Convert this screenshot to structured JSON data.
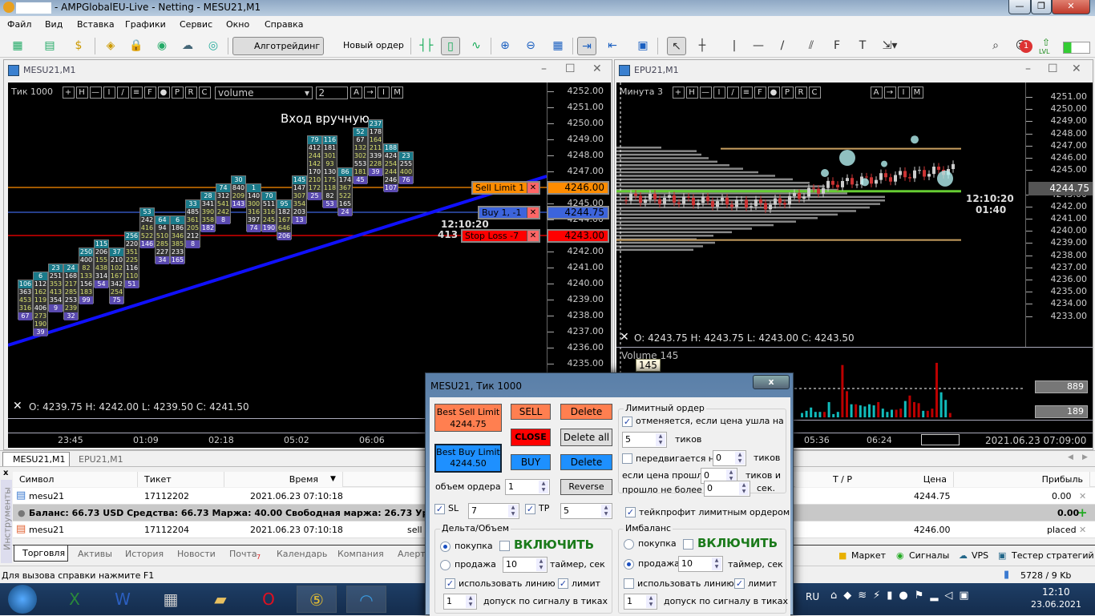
{
  "window": {
    "title": "- AMPGlobalEU-Live - Netting - MESU21,M1",
    "minimize": "—",
    "maximize": "❐",
    "close": "✕"
  },
  "menu": [
    "Файл",
    "Вид",
    "Вставка",
    "Графики",
    "Сервис",
    "Окно",
    "Справка"
  ],
  "toolbar": {
    "algo": "Алготрейдинг",
    "new_order": "Новый ордер",
    "notif_count": "1",
    "lvl": "LVL"
  },
  "left_chart": {
    "title": "MESU21,M1",
    "timeframe": "Тик  1000",
    "indicator_select": "volume",
    "indicator_value": "2",
    "tool_buttons": [
      "+",
      "H",
      "—",
      "I",
      "/",
      "≡",
      "F",
      "●",
      "P",
      "R",
      "C"
    ],
    "tool_buttons2": [
      "A",
      "→",
      "I",
      "M"
    ],
    "note": "Вход вручную.",
    "price_labels": [
      "4252.00",
      "4251.00",
      "4250.00",
      "4249.00",
      "4248.00",
      "4247.00",
      "4246.00",
      "4245.00",
      "4244.00",
      "4243.00",
      "4242.00",
      "4241.00",
      "4240.00",
      "4239.00",
      "4238.00",
      "4237.00",
      "4236.00",
      "4235.00"
    ],
    "time_labels": [
      "23:45",
      "01:09",
      "02:18",
      "05:02",
      "06:06"
    ],
    "ohlc": "O: 4239.75  H: 4242.00  L: 4239.50  C: 4241.50",
    "timer": "12:10:20",
    "timer2": "413",
    "orders": [
      {
        "label": "Sell Limit  1",
        "price": "4246.00",
        "color": "#ff8c00"
      },
      {
        "label": "Buy  1,  -1",
        "price": "4244.75",
        "color": "#3c64dc"
      },
      {
        "label": "Stop Loss  -7",
        "price": "4243.00",
        "color": "#ff0000"
      }
    ],
    "footprint": [
      {
        "top": 4240.0,
        "v": [
          "106",
          "363",
          "453",
          "316",
          "67"
        ]
      },
      {
        "top": 4240.5,
        "v": [
          "6",
          "112",
          "162",
          "119",
          "406",
          "273",
          "190",
          "39"
        ]
      },
      {
        "top": 4241.0,
        "v": [
          "23",
          "251",
          "353",
          "413",
          "354",
          "9"
        ]
      },
      {
        "top": 4241.0,
        "v": [
          "24",
          "168",
          "217",
          "285",
          "253",
          "239",
          "32"
        ]
      },
      {
        "top": 4242.0,
        "v": [
          "250",
          "400",
          "82",
          "133",
          "156",
          "183",
          "99"
        ]
      },
      {
        "top": 4242.5,
        "v": [
          "115",
          "206",
          "155",
          "438",
          "314",
          "54"
        ]
      },
      {
        "top": 4242.0,
        "v": [
          "37",
          "210",
          "102",
          "167",
          "342",
          "254",
          "75"
        ]
      },
      {
        "top": 4243.0,
        "v": [
          "256",
          "220",
          "351",
          "225",
          "116",
          "110",
          "51"
        ]
      },
      {
        "top": 4244.5,
        "v": [
          "53",
          "242",
          "416",
          "522",
          "146"
        ]
      },
      {
        "top": 4244.0,
        "v": [
          "64",
          "94",
          "510",
          "285",
          "227",
          "34"
        ]
      },
      {
        "top": 4244.0,
        "v": [
          "6",
          "186",
          "346",
          "385",
          "233",
          "165"
        ]
      },
      {
        "top": 4245.0,
        "v": [
          "33",
          "485",
          "361",
          "205",
          "212",
          "8"
        ]
      },
      {
        "top": 4245.5,
        "v": [
          "28",
          "341",
          "390",
          "358",
          "182"
        ]
      },
      {
        "top": 4246.0,
        "v": [
          "74",
          "312",
          "541",
          "242",
          "8"
        ]
      },
      {
        "top": 4246.5,
        "v": [
          "30",
          "840",
          "209",
          "143"
        ]
      },
      {
        "top": 4246.0,
        "v": [
          "1",
          "140",
          "300",
          "316",
          "397",
          "74"
        ]
      },
      {
        "top": 4245.5,
        "v": [
          "70",
          "511",
          "316",
          "245",
          "190"
        ]
      },
      {
        "top": 4245.0,
        "v": [
          "95",
          "182",
          "167",
          "646",
          "206"
        ]
      },
      {
        "top": 4246.5,
        "v": [
          "145",
          "147",
          "307",
          "354",
          "203",
          "13"
        ]
      },
      {
        "top": 4249.0,
        "v": [
          "79",
          "412",
          "244",
          "142",
          "170",
          "210",
          "172",
          "25"
        ]
      },
      {
        "top": 4249.0,
        "v": [
          "116",
          "181",
          "301",
          "93",
          "130",
          "175",
          "118",
          "82",
          "53"
        ]
      },
      {
        "top": 4247.0,
        "v": [
          "86",
          "174",
          "367",
          "522",
          "165",
          "24"
        ]
      },
      {
        "top": 4249.5,
        "v": [
          "52",
          "67",
          "132",
          "302",
          "553",
          "181",
          "45"
        ]
      },
      {
        "top": 4250.0,
        "v": [
          "237",
          "178",
          "164",
          "211",
          "339",
          "228",
          "39"
        ]
      },
      {
        "top": 4248.5,
        "v": [
          "188",
          "424",
          "254",
          "244",
          "246",
          "107"
        ]
      },
      {
        "top": 4248.0,
        "v": [
          "23",
          "255",
          "400",
          "76"
        ]
      }
    ]
  },
  "right_chart": {
    "title": "EPU21,M1",
    "timeframe": "Минута  3",
    "price_labels": [
      "4251.00",
      "4250.00",
      "4249.00",
      "4248.00",
      "4247.00",
      "4246.00",
      "4245.00",
      "4243.00",
      "4242.00",
      "4241.00",
      "4240.00",
      "4239.00",
      "4238.00",
      "4237.00",
      "4236.00",
      "4235.00",
      "4234.00",
      "4233.00"
    ],
    "current_price": "4244.75",
    "timer": "12:10:20",
    "timer2": "01:40",
    "ohlc": "O: 4243.75  H: 4243.75  L: 4243.00  C: 4243.50",
    "volume_label": "Volume 145",
    "volume_tooltip": "145",
    "vol_high": "889",
    "vol_low": "189",
    "time_labels": [
      "05:36",
      "06:24"
    ],
    "date_label": "2021.06.23 07:09:00",
    "volumes": [
      20,
      30,
      45,
      25,
      25,
      25,
      70,
      15,
      25,
      240,
      120,
      60,
      60,
      55,
      50,
      60,
      55,
      70,
      40,
      25,
      35,
      35,
      40,
      75,
      100,
      70,
      65,
      30,
      30,
      40,
      250,
      115,
      80,
      20
    ]
  },
  "chart_tabs": [
    "MESU21,M1",
    "EPU21,M1"
  ],
  "toolbox": {
    "side_label": "Инструменты",
    "columns": [
      "Символ",
      "Тикет",
      "Время",
      "T / P",
      "Цена",
      "Прибыль"
    ],
    "rows": [
      {
        "symbol": "mesu21",
        "ticket": "17112202",
        "time": "2021.06.23 07:10:18",
        "type": "",
        "price": "4244.75",
        "profit": "0.00"
      },
      {
        "symbol": "mesu21",
        "ticket": "17112204",
        "time": "2021.06.23 07:10:18",
        "type": "sell",
        "price": "4246.00",
        "profit": "placed"
      }
    ],
    "balance": "Баланс: 66.73 USD  Средства: 66.73  Маржа: 40.00  Свободная маржа: 26.73  Уровень маржи",
    "balance_profit": "0.00",
    "tabs": [
      "Торговля",
      "Активы",
      "История",
      "Новости",
      "Почта",
      "Календарь",
      "Компания",
      "Алерты"
    ],
    "mail_count": "7",
    "right_links": [
      "Маркет",
      "Сигналы",
      "VPS",
      "Тестер стратегий"
    ]
  },
  "status": {
    "help": "Для вызова справки нажмите F1",
    "traffic": "5728 / 9 Kb"
  },
  "dialog": {
    "title": "MESU21, Тик  1000",
    "close": "x",
    "best_sell": "Best Sell Limit",
    "best_sell_price": "4244.75",
    "best_buy": "Best Buy Limit",
    "best_buy_price": "4244.50",
    "sell": "SELL",
    "close_btn": "CLOSE",
    "buy": "BUY",
    "delete": "Delete",
    "delete_all": "Delete all",
    "delete2": "Delete",
    "reverse": "Reverse",
    "volume_label": "объем ордера",
    "volume": "1",
    "sl_label": "SL",
    "sl": "7",
    "tp_label": "TP",
    "tp": "5",
    "limit_group": "Лимитный ордер",
    "cancel_label": "отменяется, если цена ушла на",
    "cancel_ticks": "5",
    "ticks": "тиков",
    "move_label": "передвигается на",
    "move_ticks": "0",
    "ticks2": "тиков",
    "if_price": "если цена прошла",
    "if_price_val": "0",
    "ticks_and": "тиков и",
    "passed": "прошло не более",
    "passed_val": "0",
    "sec": "сек.",
    "tp_limit": "тейкпрофит лимитным ордером",
    "delta": {
      "title": "Дельта/Объем",
      "buy": "покупка",
      "sell": "продажа",
      "enable": "ВКЛЮЧИТЬ",
      "timer": "10",
      "timer_label": "таймер, сек",
      "use_line": "использовать линию",
      "limit": "лимит",
      "tol": "1",
      "tol_label": "допуск по сигналу в тиках"
    },
    "imb": {
      "title": "Имбаланс",
      "buy": "покупка",
      "sell": "продажа",
      "enable": "ВКЛЮЧИТЬ",
      "timer": "10",
      "timer_label": "таймер, сек",
      "use_line": "использовать линию",
      "limit": "лимит",
      "tol": "1",
      "tol_label": "допуск по сигналу в тиках"
    }
  },
  "taskbar": {
    "lang": "RU",
    "time": "12:10",
    "date": "23.06.2021"
  }
}
